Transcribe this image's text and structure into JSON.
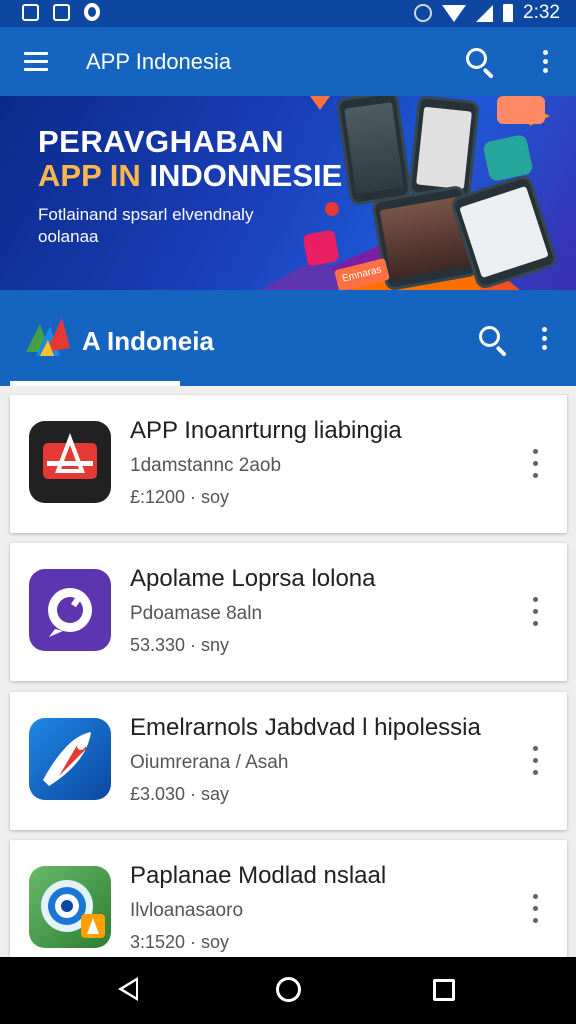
{
  "status_bar": {
    "time": "2:32"
  },
  "app_bar": {
    "title": "APP Indonesia"
  },
  "banner": {
    "headline_line1": "PERAVGHABAN",
    "headline_line2_accent": "APP IN",
    "headline_line2_rest": " INDONNESIE",
    "subtitle": "Fotlainand spsarl elvendnaly oolanaa",
    "badge_text": "Emnaras"
  },
  "section": {
    "title": "A Indoneia"
  },
  "apps": [
    {
      "name": "APP Inoanrturng liabingia",
      "publisher": "1damstannc 2aob",
      "meta": "£:1200 · soy",
      "icon": "red-logo-icon",
      "color": "#212121"
    },
    {
      "name": "Apolame Loprsa lolona",
      "publisher": "Pdoamase 8aln",
      "meta": "53.330 · sny",
      "icon": "purple-camera-icon",
      "color": "#5e35b1"
    },
    {
      "name": "Emelrarnols Jabdvad l hipolessia",
      "publisher": "Oiumrerana / Asah",
      "meta": "£3.030 · say",
      "icon": "blue-compass-icon",
      "color": "#1565c0"
    },
    {
      "name": "Paplanae Modlad nslaal",
      "publisher": "Ilvloanasaoro",
      "meta": "3:1520 · soy",
      "icon": "green-target-icon",
      "color": "#43a047"
    }
  ]
}
